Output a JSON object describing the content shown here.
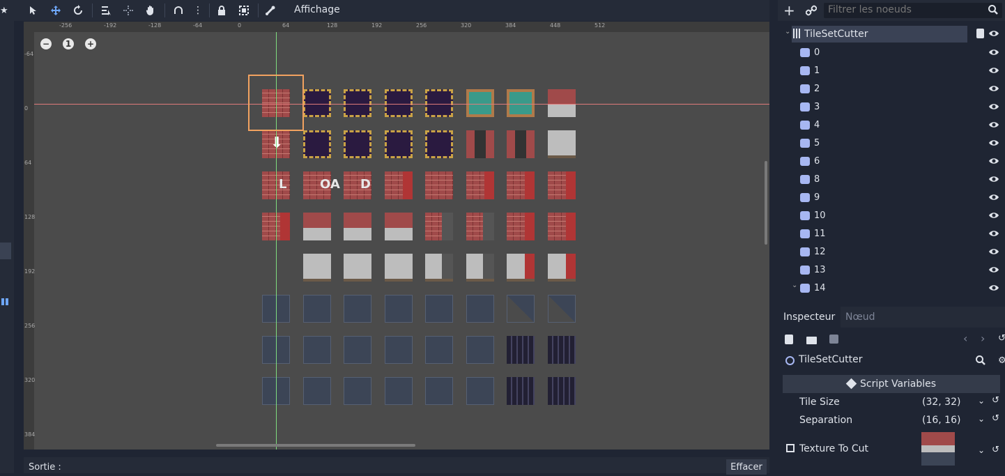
{
  "toolbar": {
    "view_menu": "Affichage"
  },
  "ruler": {
    "top": [
      "-256",
      "-192",
      "-128",
      "-64",
      "0",
      "64",
      "128",
      "192",
      "256",
      "320",
      "384",
      "448",
      "512"
    ],
    "left": [
      "-64",
      "0",
      "64",
      "128",
      "192",
      "256",
      "320",
      "384"
    ]
  },
  "zoom": {
    "minus": "−",
    "reset": "1",
    "plus": "+"
  },
  "tileset": {
    "rows": [
      [
        "brick",
        "dark",
        "dark",
        "dark",
        "dark",
        "window",
        "window",
        "brick-gray"
      ],
      [
        "brick-arrow",
        "dark",
        "dark",
        "dark",
        "dark",
        "brick-vent",
        "brick-vent",
        "gray"
      ],
      [
        "brick-L",
        "brick-OA",
        "brick-D",
        "brick-red",
        "brick",
        "brick-red",
        "brick-red",
        "brick-red"
      ],
      [
        "brick-red",
        "brick-gray",
        "brick-gray",
        "brick-gray",
        "brick-door",
        "brick-door",
        "brick-red",
        "brick-red"
      ],
      [
        "empty",
        "gray",
        "gray",
        "gray",
        "gray-door",
        "gray-door",
        "gray-red",
        "gray-red"
      ],
      [
        "stone",
        "stone",
        "stone",
        "stone",
        "stone",
        "stone",
        "stone-diag",
        "stone-diag"
      ],
      [
        "stone",
        "stone",
        "stone",
        "stone",
        "stone",
        "stone",
        "pillar",
        "pillar"
      ],
      [
        "stone",
        "stone",
        "stone",
        "stone",
        "stone",
        "stone",
        "pillar",
        "pillar"
      ]
    ],
    "letters": {
      "L": "L",
      "OA": "OA",
      "D": "D"
    }
  },
  "output": {
    "label": "Sortie :",
    "clear_button": "Effacer"
  },
  "scene": {
    "filter_placeholder": "Filtrer les noeuds",
    "root": "TileSetCutter",
    "children": [
      "0",
      "1",
      "2",
      "3",
      "4",
      "5",
      "6",
      "8",
      "9",
      "10",
      "11",
      "12",
      "13",
      "14"
    ]
  },
  "inspector": {
    "tabs": [
      "Inspecteur",
      "Nœud"
    ],
    "object_name": "TileSetCutter",
    "section": "Script Variables",
    "properties": [
      {
        "label": "Tile Size",
        "value": "(32, 32)"
      },
      {
        "label": "Separation",
        "value": "(16, 16)"
      },
      {
        "label": "Texture To Cut",
        "value": ""
      }
    ]
  },
  "colors": {
    "bg": "#1f2533",
    "panel": "#252b38",
    "viewport": "#4b4b4b",
    "accent": "#a7b7f2",
    "selection": "#f2a260"
  }
}
